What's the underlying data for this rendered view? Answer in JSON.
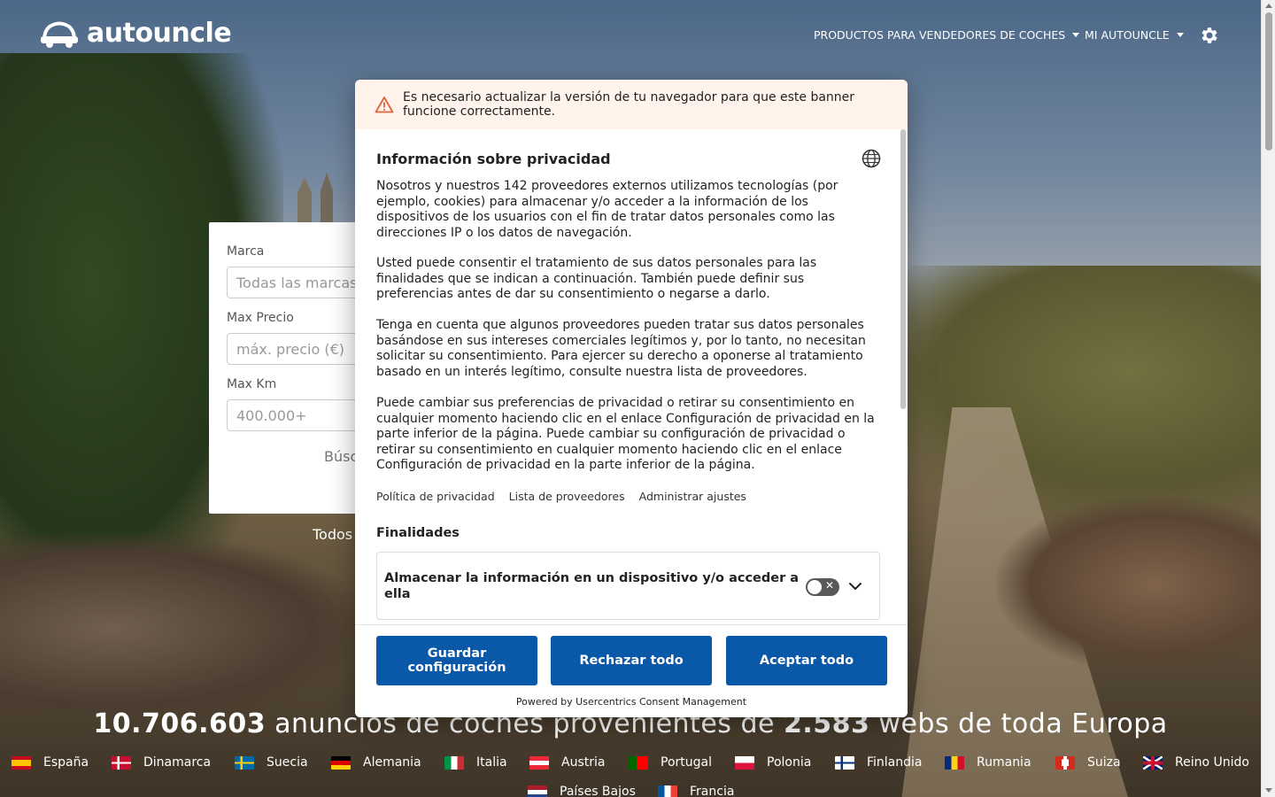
{
  "header": {
    "logo_text": "autouncle",
    "nav": [
      {
        "label": "PRODUCTOS PARA VENDEDORES DE COCHES"
      },
      {
        "label": "MI AUTOUNCLE"
      }
    ],
    "settings_icon": "gear-icon"
  },
  "search": {
    "brand_label": "Marca",
    "brand_placeholder": "Todas las marcas",
    "price_label": "Max Precio",
    "price_placeholder": "máx. precio (€)",
    "km_label": "Max Km",
    "km_placeholder": "400.000+",
    "button_label": "Búsc",
    "all_link": "Todos"
  },
  "headline": {
    "count": "10.706.603",
    "middle": " anuncios de coches provenientes de ",
    "sites": "2.583",
    "end": " webs de toda Europa"
  },
  "countries": [
    {
      "name": "España"
    },
    {
      "name": "Dinamarca"
    },
    {
      "name": "Suecia"
    },
    {
      "name": "Alemania"
    },
    {
      "name": "Italia"
    },
    {
      "name": "Austria"
    },
    {
      "name": "Portugal"
    },
    {
      "name": "Polonia"
    },
    {
      "name": "Finlandia"
    },
    {
      "name": "Rumania"
    },
    {
      "name": "Suiza"
    },
    {
      "name": "Reino Unido"
    },
    {
      "name": "Países Bajos"
    },
    {
      "name": "Francia"
    }
  ],
  "consent": {
    "warning": "Es necesario actualizar la versión de tu navegador para que este banner funcione correctamente.",
    "title": "Información sobre privacidad",
    "paragraphs": [
      "Nosotros y nuestros 142 proveedores externos utilizamos tecnologías (por ejemplo, cookies) para almacenar y/o acceder a la información de los dispositivos de los usuarios con el fin de tratar datos personales como las direcciones IP o los datos de navegación.",
      "Usted puede consentir el tratamiento de sus datos personales para las finalidades que se indican a continuación. También puede definir sus preferencias antes de dar su consentimiento o negarse a darlo.",
      "Tenga en cuenta que algunos proveedores pueden tratar sus datos personales basándose en sus intereses comerciales legítimos y, por lo tanto, no necesitan solicitar su consentimiento. Para ejercer su derecho a oponerse al tratamiento basado en un interés legítimo, consulte nuestra lista de proveedores.",
      "Puede cambiar sus preferencias de privacidad o retirar su consentimiento en cualquier momento haciendo clic en el enlace Configuración de privacidad en la parte inferior de la página. Puede cambiar su configuración de privacidad o retirar su consentimiento en cualquier momento haciendo clic en el enlace Configuración de privacidad en la parte inferior de la página."
    ],
    "links": [
      "Política de privacidad",
      "Lista de proveedores",
      "Administrar ajustes"
    ],
    "purposes_title": "Finalidades",
    "purpose_item": "Almacenar la información en un dispositivo y/o acceder a ella",
    "purpose_toggle_on": false,
    "buttons": {
      "save": "Guardar configuración",
      "reject": "Rechazar todo",
      "accept": "Aceptar todo"
    },
    "powered_by": "Powered by Usercentrics Consent Management",
    "button_color": "#0a58a8"
  }
}
